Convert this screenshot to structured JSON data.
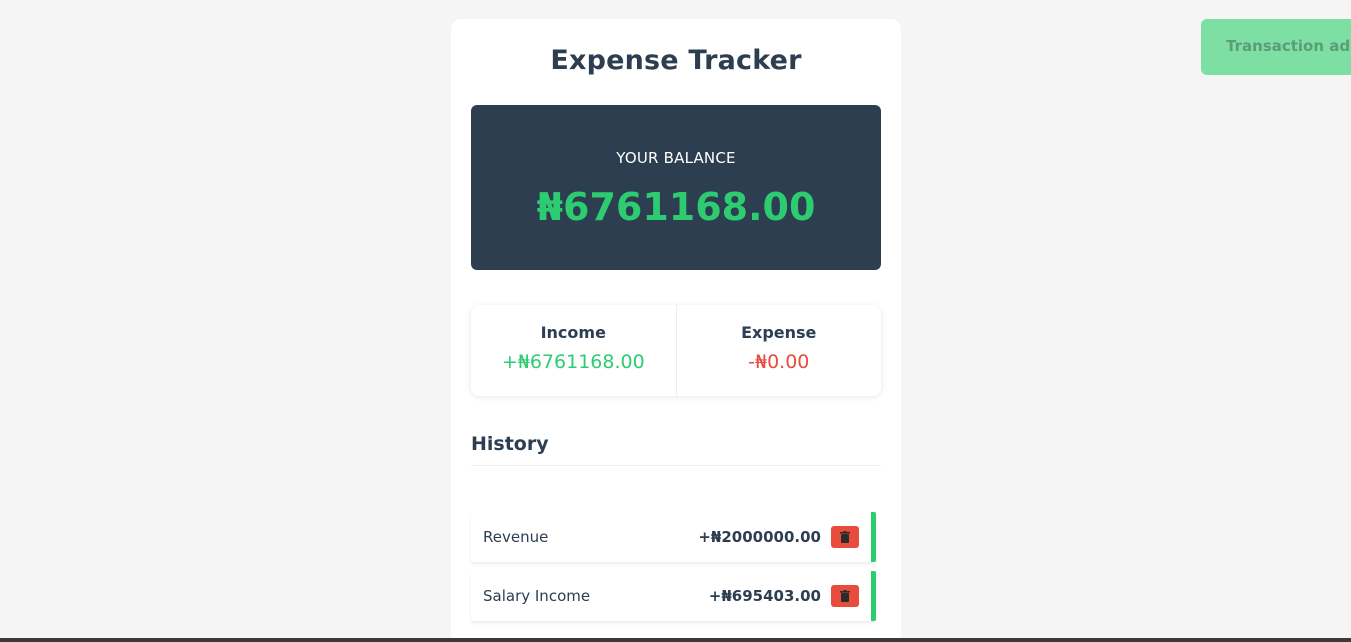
{
  "header": {
    "title": "Expense Tracker"
  },
  "balance": {
    "label": "YOUR BALANCE",
    "amount": "₦6761168.00"
  },
  "summary": {
    "income_label": "Income",
    "income_value": "+₦6761168.00",
    "expense_label": "Expense",
    "expense_value": "-₦0.00"
  },
  "history": {
    "title": "History",
    "items": [
      {
        "text": "Revenue",
        "amount": "+₦2000000.00",
        "type": "income"
      },
      {
        "text": "Salary Income",
        "amount": "+₦695403.00",
        "type": "income"
      }
    ]
  },
  "toast": {
    "message": "Transaction added"
  },
  "colors": {
    "primary": "#2c3e50",
    "income": "#2ecc71",
    "expense": "#e74c3c",
    "toast": "#7ddfa4"
  },
  "icons": {
    "delete": "trash-icon"
  }
}
